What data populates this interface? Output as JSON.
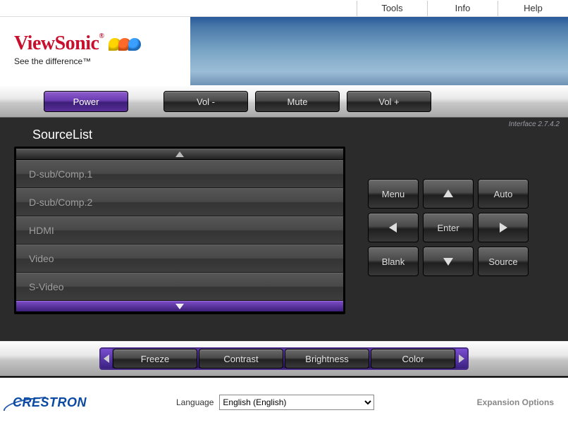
{
  "topmenu": {
    "tools": "Tools",
    "info": "Info",
    "help": "Help"
  },
  "brand": {
    "name": "ViewSonic",
    "tagline": "See the difference™"
  },
  "controls": {
    "power": "Power",
    "voldown": "Vol -",
    "mute": "Mute",
    "volup": "Vol +"
  },
  "version": "Interface 2.7.4.2",
  "sourcelist": {
    "title": "SourceList",
    "items": [
      "D-sub/Comp.1",
      "D-sub/Comp.2",
      "HDMI",
      "Video",
      "S-Video"
    ]
  },
  "pad": {
    "menu": "Menu",
    "auto": "Auto",
    "enter": "Enter",
    "blank": "Blank",
    "source": "Source"
  },
  "lower": {
    "freeze": "Freeze",
    "contrast": "Contrast",
    "brightness": "Brightness",
    "color": "Color"
  },
  "footer": {
    "crestron": "CRESTRON",
    "language_label": "Language",
    "language_value": "English (English)",
    "expand": "Expansion Options"
  }
}
